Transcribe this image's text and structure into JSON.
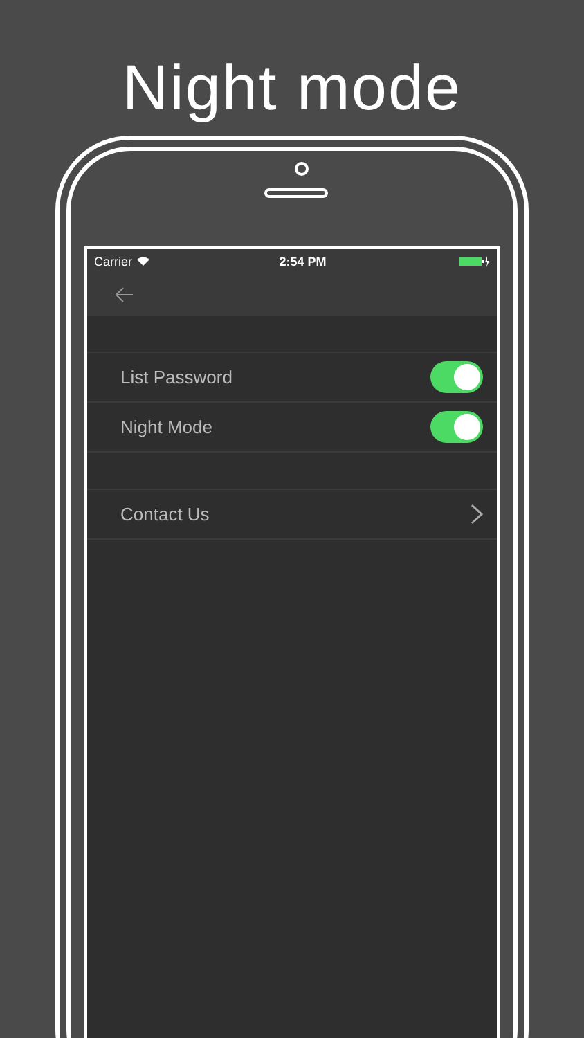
{
  "headline": "Night mode",
  "status_bar": {
    "carrier": "Carrier",
    "time": "2:54 PM"
  },
  "sections": [
    {
      "rows": [
        {
          "label": "List Password",
          "kind": "toggle",
          "on": true
        },
        {
          "label": "Night Mode",
          "kind": "toggle",
          "on": true
        }
      ]
    },
    {
      "rows": [
        {
          "label": "Contact Us",
          "kind": "disclosure"
        }
      ]
    }
  ]
}
